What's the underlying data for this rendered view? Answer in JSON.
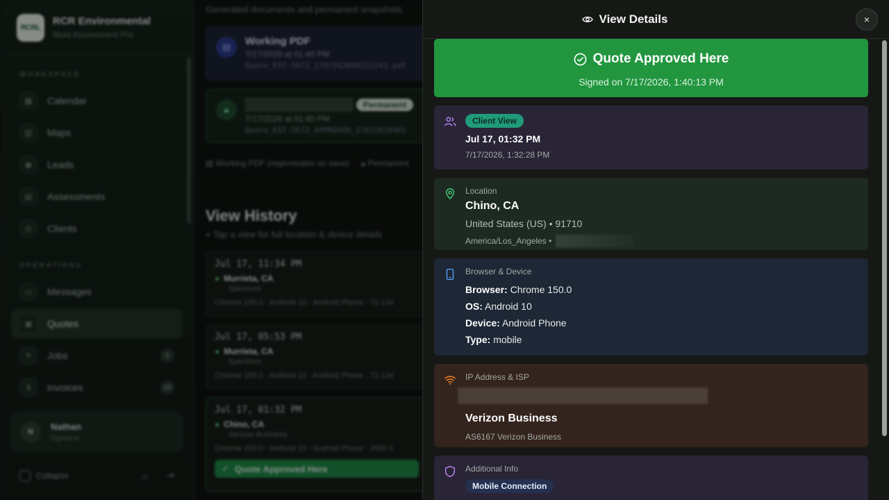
{
  "sidebar": {
    "brand_title": "RCR Environmental",
    "brand_sub": "Mold Assessment Pro",
    "brand_logo_text": "RCRL",
    "section_workspace": "WORKSPACE",
    "section_operations": "OPERATIONS",
    "workspace_items": [
      {
        "label": "Calendar",
        "icon": "calendar-icon"
      },
      {
        "label": "Maps",
        "icon": "map-icon"
      },
      {
        "label": "Leads",
        "icon": "leads-icon"
      },
      {
        "label": "Assessments",
        "icon": "clipboard-icon"
      },
      {
        "label": "Clients",
        "icon": "users-icon"
      }
    ],
    "operations_items": [
      {
        "label": "Messages",
        "icon": "message-icon"
      },
      {
        "label": "Quotes",
        "icon": "quote-icon"
      },
      {
        "label": "Jobs",
        "icon": "tools-icon",
        "badge": "5"
      },
      {
        "label": "Invoices",
        "icon": "invoice-icon",
        "badge": "16"
      }
    ],
    "user": {
      "initial": "N",
      "name": "Nathan",
      "status": "Signed in"
    },
    "collapse_label": "Collapse"
  },
  "documents": {
    "subtitle": "Generated documents and permanent snapshots",
    "working": {
      "title": "Working PDF",
      "date": "7/17/2026 at 01:40 PM",
      "file": "Quote_EST-5672_1707262040222243.pdf"
    },
    "permanent": {
      "badge": "Permanent",
      "date": "7/17/2026 at 01:40 PM",
      "file": "Quote_EST-5672_APPROVED_17072620401"
    },
    "legend_working": "Working PDF (regenerates on save)",
    "legend_permanent": "Permanent"
  },
  "history": {
    "title": "View History",
    "subtitle": "Tap a view for full location & device details",
    "views": [
      {
        "time": "Jul 17, 11:34 PM",
        "city": "Murrieta, CA",
        "isp": "Spectrum",
        "device": "Chrome 150.0 · Android 10 · Android Phone  ·  72.134"
      },
      {
        "time": "Jul 17, 05:53 PM",
        "city": "Murrieta, CA",
        "isp": "Spectrum",
        "device": "Chrome 150.0 · Android 10 · Android Phone  ·  72.134"
      },
      {
        "time": "Jul 17, 01:32 PM",
        "city": "Chino, CA",
        "isp": "Verizon Business",
        "device": "Chrome 150.0 · Android 10 · Android Phone  ·  2600:1",
        "approved_label": "Quote Approved Here"
      }
    ]
  },
  "drawer": {
    "title": "View Details",
    "close_label": "×",
    "approved": {
      "title": "Quote Approved Here",
      "signed": "Signed on 7/17/2026, 1:40:13 PM"
    },
    "client": {
      "pill": "Client View",
      "time": "Jul 17, 01:32 PM",
      "timestamp": "7/17/2026, 1:32:28 PM"
    },
    "location": {
      "label": "Location",
      "city": "Chino, CA",
      "country_zip": "United States (US) • 91710",
      "timezone": "America/Los_Angeles •"
    },
    "device": {
      "label": "Browser & Device",
      "rows": [
        {
          "key": "Browser:",
          "value": "Chrome 150.0"
        },
        {
          "key": "OS:",
          "value": "Android 10"
        },
        {
          "key": "Device:",
          "value": "Android Phone"
        },
        {
          "key": "Type:",
          "value": "mobile"
        }
      ]
    },
    "network": {
      "label": "IP Address & ISP",
      "isp": "Verizon Business",
      "asn": "AS6167 Verizon Business"
    },
    "additional": {
      "label": "Additional Info",
      "pill": "Mobile Connection"
    }
  },
  "colors": {
    "approved_green": "#22963f",
    "accent_teal": "#1f9b79"
  }
}
